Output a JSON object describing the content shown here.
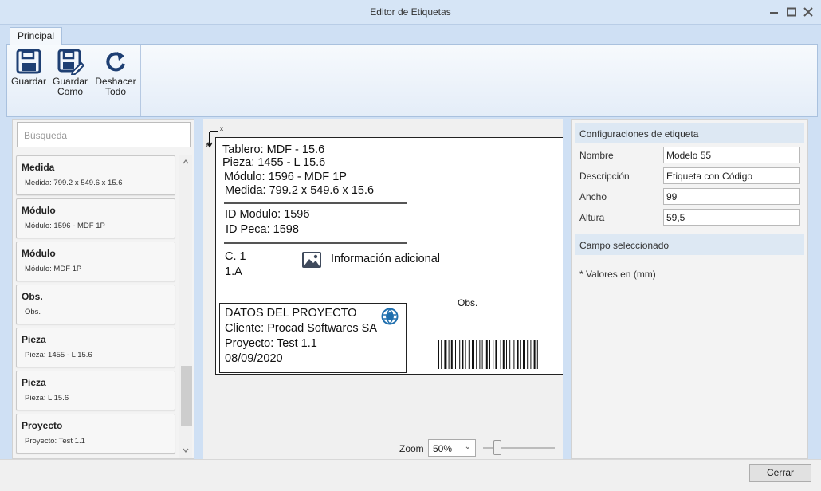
{
  "window": {
    "title": "Editor de Etiquetas"
  },
  "ribbon": {
    "tab": "Principal",
    "buttons": {
      "save": "Guardar",
      "save_as": "Guardar Como",
      "undo_all": "Deshacer Todo"
    }
  },
  "fields_panel": {
    "search_placeholder": "Búsqueda",
    "items": [
      {
        "name": "Medida",
        "value": "Medida: 799.2 x 549.6 x 15.6"
      },
      {
        "name": "Módulo",
        "value": "Módulo: 1596 - MDF 1P"
      },
      {
        "name": "Módulo",
        "value": "Módulo: MDF 1P"
      },
      {
        "name": "Obs.",
        "value": "Obs."
      },
      {
        "name": "Pieza",
        "value": "Pieza: 1455 - L 15.6"
      },
      {
        "name": "Pieza",
        "value": "Pieza: L 15.6"
      },
      {
        "name": "Proyecto",
        "value": "Proyecto: Test 1.1"
      }
    ]
  },
  "canvas": {
    "axis_x": "x",
    "axis_y": "y",
    "label": {
      "tablero": "Tablero: MDF - 15.6",
      "pieza": "Pieza: 1455 - L 15.6",
      "modulo": "Módulo: 1596 - MDF 1P",
      "medida": "Medida: 799.2 x 549.6 x 15.6",
      "id_modulo": "ID Modulo: 1596",
      "id_peca": "ID Peca: 1598",
      "c": "C. 1",
      "a": "1.A",
      "info_adicional": "Información adicional",
      "obs": "Obs.",
      "proyecto_titulo": "DATOS DEL PROYECTO",
      "cliente": "Cliente: Procad Softwares SA",
      "proyecto": "Proyecto: Test 1.1",
      "fecha": "08/09/2020"
    }
  },
  "zoom": {
    "label": "Zoom",
    "value": "50%",
    "arrow": "⌄"
  },
  "properties": {
    "config_header": "Configuraciones de etiqueta",
    "fields": [
      {
        "label": "Nombre",
        "value": "Modelo 55"
      },
      {
        "label": "Descripción",
        "value": "Etiqueta con Código"
      },
      {
        "label": "Ancho",
        "value": "99"
      },
      {
        "label": "Altura",
        "value": "59,5"
      }
    ],
    "selected_header": "Campo seleccionado",
    "note": "* Valores en (mm)"
  },
  "footer": {
    "close": "Cerrar"
  }
}
